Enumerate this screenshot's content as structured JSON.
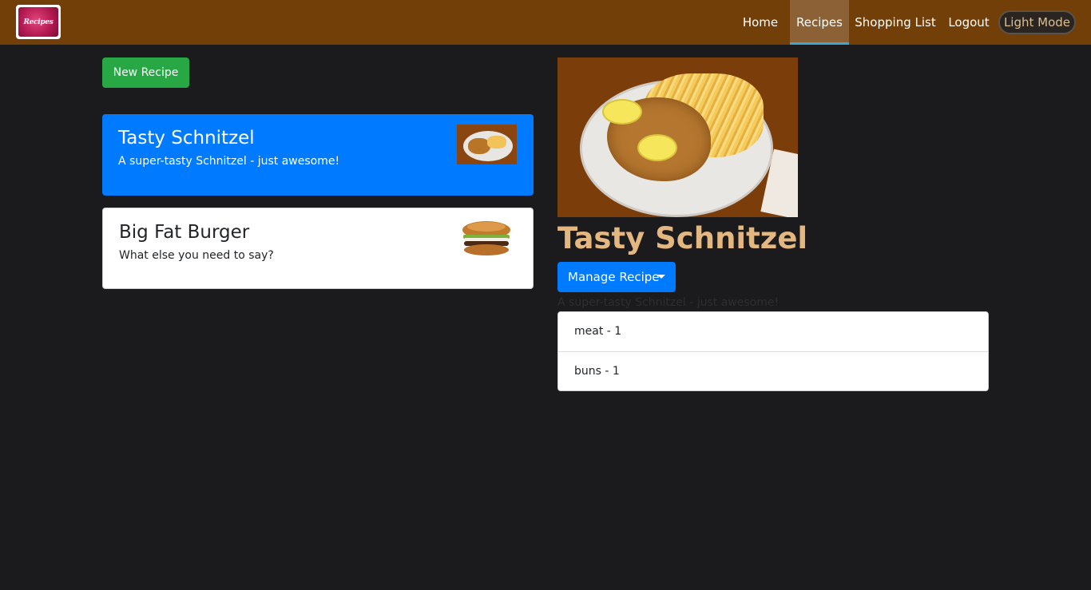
{
  "navbar": {
    "logo_text": "Recipes",
    "links": [
      {
        "label": "Home",
        "active": false
      },
      {
        "label": "Recipes",
        "active": true
      },
      {
        "label": "Shopping List",
        "active": false
      },
      {
        "label": "Logout",
        "active": false
      }
    ],
    "mode_toggle": "Light Mode"
  },
  "recipe_list": {
    "new_button": "New Recipe",
    "items": [
      {
        "name": "Tasty Schnitzel",
        "description": "A super-tasty Schnitzel - just awesome!",
        "active": true,
        "image": "schnitzel-image"
      },
      {
        "name": "Big Fat Burger",
        "description": "What else you need to say?",
        "active": false,
        "image": "burger-image"
      }
    ]
  },
  "recipe_detail": {
    "name": "Tasty Schnitzel",
    "manage_button": "Manage Recipe",
    "description": "A super-tasty Schnitzel - just awesome!",
    "ingredients": [
      "meat - 1",
      "buns - 1"
    ]
  },
  "colors": {
    "navbar": "#733f09",
    "background": "#1b1b1d",
    "primary": "#007bff",
    "success": "#28a745",
    "title": "#e4b680"
  }
}
